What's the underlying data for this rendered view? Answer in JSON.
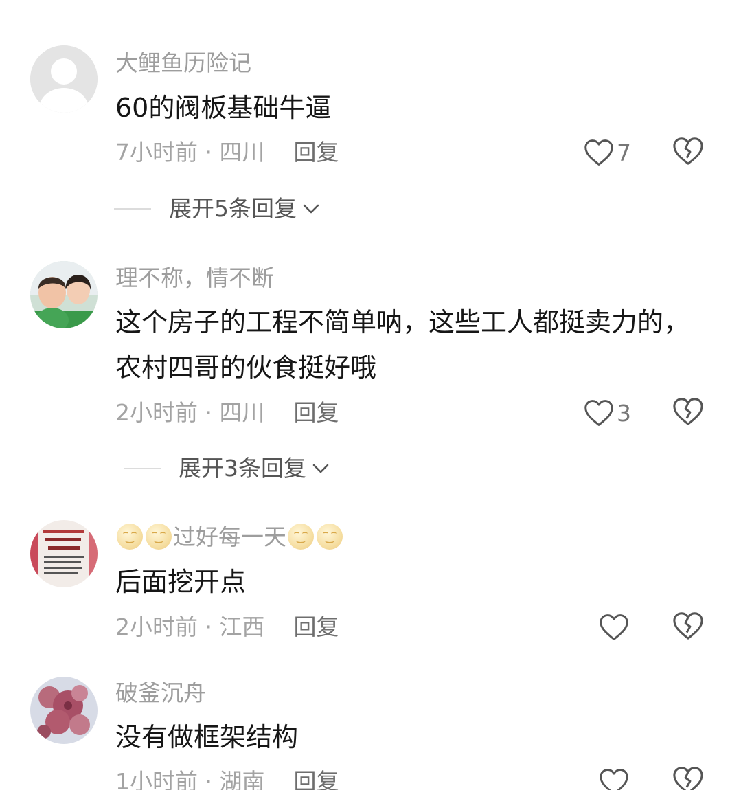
{
  "comments": [
    {
      "username": "大鲤鱼历险记",
      "content": "60的阀板基础牛逼",
      "time": "7小时前",
      "location": "四川",
      "reply_label": "回复",
      "likes": "7",
      "expand_label": "展开5条回复",
      "avatar": "default-avatar"
    },
    {
      "username": "理不称，情不断",
      "content": "这个房子的工程不简单呐，这些工人都挺卖力的，农村四哥的伙食挺好哦",
      "time": "2小时前",
      "location": "四川",
      "reply_label": "回复",
      "likes": "3",
      "expand_label": "展开3条回复",
      "avatar": "photo-avatar"
    },
    {
      "username": "过好每一天",
      "content": "后面挖开点",
      "time": "2小时前",
      "location": "江西",
      "reply_label": "回复",
      "likes": "",
      "avatar": "text-image-avatar"
    },
    {
      "username": "破釜沉舟",
      "content": "没有做框架结构",
      "time": "1小时前",
      "location": "湖南",
      "reply_label": "回复",
      "likes": "",
      "avatar": "flower-avatar"
    }
  ],
  "separator": " · ",
  "icons": {
    "like": "heart-outline-icon",
    "dislike": "broken-heart-icon",
    "expand": "chevron-down-icon"
  },
  "colors": {
    "username": "#9d9d9d",
    "content": "#161616",
    "meta": "#a3a3a3",
    "icon": "#555555"
  }
}
